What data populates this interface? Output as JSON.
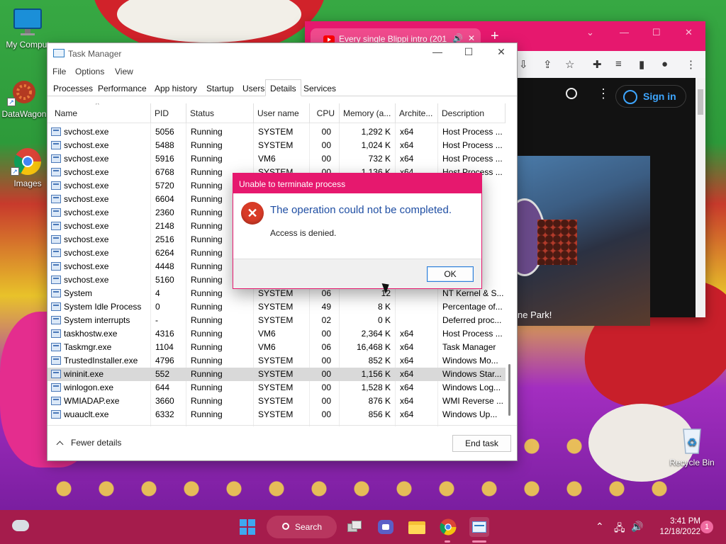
{
  "desktop": {
    "icons": [
      {
        "label": "My Comput",
        "icon": "monitor-icon"
      },
      {
        "label": "DataWagon",
        "icon": "datawagon-icon"
      },
      {
        "label": "Images",
        "icon": "chrome-icon"
      },
      {
        "label": "Recycle Bin",
        "icon": "recycle-bin-icon"
      }
    ]
  },
  "browser": {
    "tab_title": "Every single Blippi intro (201",
    "new_tab": "+",
    "signin_label": "Sign in",
    "video_caption": "ne Park!",
    "accent": "#e6186e"
  },
  "taskmanager": {
    "title": "Task Manager",
    "menu": [
      "File",
      "Options",
      "View"
    ],
    "tabs": [
      "Processes",
      "Performance",
      "App history",
      "Startup",
      "Users",
      "Details",
      "Services"
    ],
    "active_tab": "Details",
    "columns": [
      "Name",
      "PID",
      "Status",
      "User name",
      "CPU",
      "Memory (a...",
      "Archite...",
      "Description"
    ],
    "rows": [
      [
        "svchost.exe",
        "5056",
        "Running",
        "SYSTEM",
        "00",
        "1,292 K",
        "x64",
        "Host Process ..."
      ],
      [
        "svchost.exe",
        "5488",
        "Running",
        "SYSTEM",
        "00",
        "1,024 K",
        "x64",
        "Host Process ..."
      ],
      [
        "svchost.exe",
        "5916",
        "Running",
        "VM6",
        "00",
        "732 K",
        "x64",
        "Host Process ..."
      ],
      [
        "svchost.exe",
        "6768",
        "Running",
        "SYSTEM",
        "00",
        "1,136 K",
        "x64",
        "Host Process ..."
      ],
      [
        "svchost.exe",
        "5720",
        "Running",
        "",
        "",
        "",
        "",
        "ss ..."
      ],
      [
        "svchost.exe",
        "6604",
        "Running",
        "",
        "",
        "",
        "",
        "ss ..."
      ],
      [
        "svchost.exe",
        "2360",
        "Running",
        "",
        "",
        "",
        "",
        "ss ..."
      ],
      [
        "svchost.exe",
        "2148",
        "Running",
        "",
        "",
        "",
        "",
        "ss ..."
      ],
      [
        "svchost.exe",
        "2516",
        "Running",
        "",
        "",
        "",
        "",
        "ss ..."
      ],
      [
        "svchost.exe",
        "6264",
        "Running",
        "",
        "",
        "",
        "",
        "ss ..."
      ],
      [
        "svchost.exe",
        "4448",
        "Running",
        "",
        "",
        "",
        "",
        "ss ..."
      ],
      [
        "svchost.exe",
        "5160",
        "Running",
        "",
        "",
        "",
        "",
        "ss ..."
      ],
      [
        "System",
        "4",
        "Running",
        "SYSTEM",
        "06",
        "12",
        "",
        "NT Kernel & S..."
      ],
      [
        "System Idle Process",
        "0",
        "Running",
        "SYSTEM",
        "49",
        "8 K",
        "",
        "Percentage of..."
      ],
      [
        "System interrupts",
        "-",
        "Running",
        "SYSTEM",
        "02",
        "0 K",
        "",
        "Deferred proc..."
      ],
      [
        "taskhostw.exe",
        "4316",
        "Running",
        "VM6",
        "00",
        "2,364 K",
        "x64",
        "Host Process ..."
      ],
      [
        "Taskmgr.exe",
        "1104",
        "Running",
        "VM6",
        "06",
        "16,468 K",
        "x64",
        "Task Manager"
      ],
      [
        "TrustedInstaller.exe",
        "4796",
        "Running",
        "SYSTEM",
        "00",
        "852 K",
        "x64",
        "Windows Mo..."
      ],
      [
        "wininit.exe",
        "552",
        "Running",
        "SYSTEM",
        "00",
        "1,156 K",
        "x64",
        "Windows Star..."
      ],
      [
        "winlogon.exe",
        "644",
        "Running",
        "SYSTEM",
        "00",
        "1,528 K",
        "x64",
        "Windows Log..."
      ],
      [
        "WMIADAP.exe",
        "3660",
        "Running",
        "SYSTEM",
        "00",
        "876 K",
        "x64",
        "WMI Reverse ..."
      ],
      [
        "wuauclt.exe",
        "6332",
        "Running",
        "SYSTEM",
        "00",
        "856 K",
        "x64",
        "Windows Up..."
      ]
    ],
    "selected_row": "wininit.exe",
    "fewer_details": "Fewer details",
    "end_task": "End task"
  },
  "dialog": {
    "title": "Unable to terminate process",
    "message": "The operation could not be completed.",
    "detail": "Access is denied.",
    "ok": "OK",
    "icon": "error-icon",
    "accent": "#e6186e"
  },
  "taskbar": {
    "search_label": "Search",
    "time": "3:41 PM",
    "date": "12/18/2022",
    "notification_count": "1",
    "color": "#a51c4c"
  }
}
